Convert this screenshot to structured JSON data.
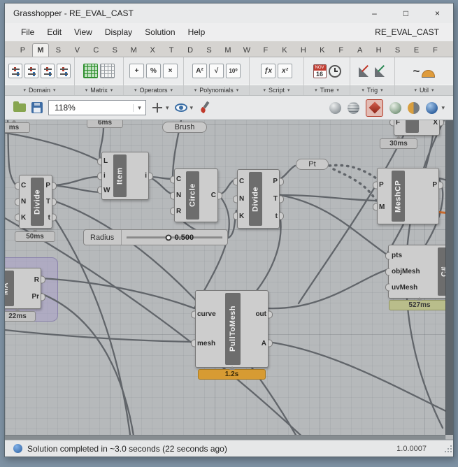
{
  "window": {
    "title": "Grasshopper - RE_EVAL_CAST"
  },
  "glyphs": {
    "minimize": "–",
    "maximize": "□",
    "close": "×",
    "dropdown": "▾",
    "side_arrow": "▾",
    "plus": "+",
    "percent": "%",
    "times": "×",
    "a_squared": "A²",
    "sqrt": "√",
    "ten_pow": "10⁰",
    "fx": "ƒx",
    "x_squared": "x²",
    "month": "NOV",
    "day": "16",
    "curve": "~"
  },
  "menubar": {
    "items": [
      "File",
      "Edit",
      "View",
      "Display",
      "Solution",
      "Help"
    ],
    "doc_tab": "RE_EVAL_CAST"
  },
  "tabstrip": {
    "letters": [
      "P",
      "M",
      "S",
      "V",
      "C",
      "S",
      "M",
      "X",
      "T",
      "D",
      "S",
      "M",
      "W",
      "F",
      "K",
      "H",
      "K",
      "F",
      "A",
      "H",
      "S",
      "E",
      "F"
    ],
    "active": "M"
  },
  "ribbon": {
    "groups": [
      {
        "label": "Domain"
      },
      {
        "label": "Matrix"
      },
      {
        "label": "Operators"
      },
      {
        "label": "Polynomials"
      },
      {
        "label": "Script"
      },
      {
        "label": "Time"
      },
      {
        "label": "Trig"
      },
      {
        "label": "Util"
      }
    ]
  },
  "canvas_toolbar": {
    "zoom": "118%"
  },
  "canvas": {
    "components": [
      {
        "name": "Divide",
        "inputs": [
          "C",
          "N",
          "K"
        ],
        "outputs": [
          "P",
          "T",
          "t"
        ],
        "time": "50ms"
      },
      {
        "name": "Item",
        "inputs": [
          "L",
          "i",
          "W"
        ],
        "outputs": [
          "i"
        ]
      },
      {
        "name": "Circle",
        "inputs": [
          "C",
          "N",
          "R"
        ],
        "outputs": [
          "C"
        ]
      },
      {
        "name": "Divide",
        "inputs": [
          "C",
          "N",
          "K"
        ],
        "outputs": [
          "P",
          "T",
          "t"
        ]
      },
      {
        "name": "MeshCP",
        "inputs": [
          "P",
          "M"
        ],
        "outputs": [
          "P"
        ]
      },
      {
        "name": "PullToMesh",
        "inputs": [
          "curve",
          "mesh"
        ],
        "outputs": [
          "out",
          "A"
        ],
        "time": "1.2s"
      },
      {
        "name": "C#",
        "inputs": [
          "pts",
          "objMesh",
          "uvMesh"
        ],
        "time": "527ms"
      },
      {
        "name": "MA",
        "outputs": [
          "R",
          "Pr"
        ],
        "time": "22ms"
      },
      {
        "name": "",
        "inputs": [
          "F"
        ],
        "outputs": [
          "X"
        ],
        "time": "30ms"
      }
    ],
    "labels": {
      "partial_ms": "ms",
      "six_ms": "6ms",
      "brush": "Brush",
      "pt": "Pt"
    },
    "slider": {
      "label": "Radius",
      "value": "0.500"
    }
  },
  "statusbar": {
    "message": "Solution completed in ~3.0 seconds (22 seconds ago)",
    "version": "1.0.0007"
  }
}
